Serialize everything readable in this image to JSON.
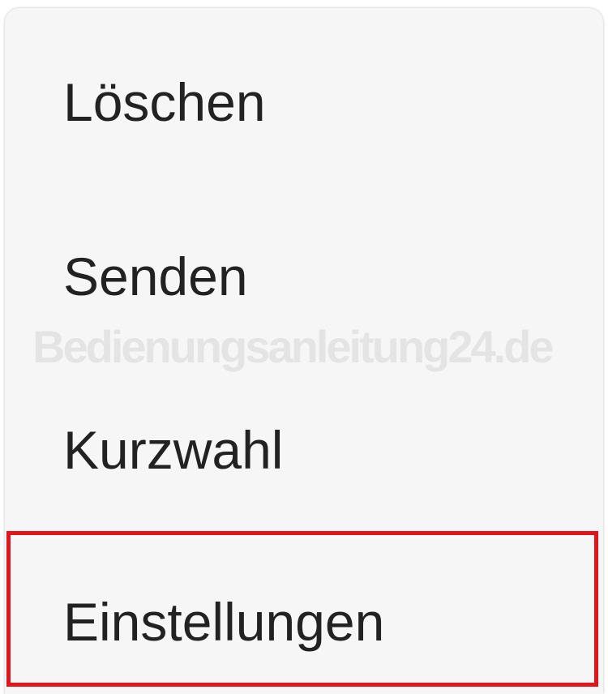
{
  "menu": {
    "items": [
      {
        "label": "Löschen"
      },
      {
        "label": "Senden"
      },
      {
        "label": "Kurzwahl"
      },
      {
        "label": "Einstellungen",
        "highlighted": true
      }
    ]
  },
  "watermark": {
    "text": "Bedienungsanleitung24.de"
  },
  "colors": {
    "menu_background": "#f6f6f6",
    "text": "#222222",
    "highlight": "#e0161b"
  }
}
